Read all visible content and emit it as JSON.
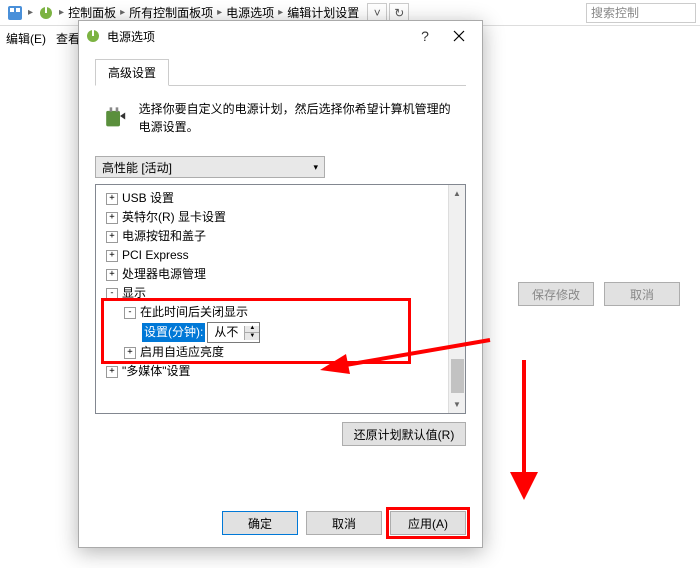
{
  "breadcrumb": {
    "items": [
      "控制面板",
      "所有控制面板项",
      "电源选项",
      "编辑计划设置"
    ],
    "search_placeholder": "搜索控制"
  },
  "menubar": {
    "edit": "编辑(E)",
    "view": "查看"
  },
  "bg_buttons": {
    "save": "保存修改",
    "cancel": "取消"
  },
  "dialog": {
    "title": "电源选项",
    "tab": "高级设置",
    "description": "选择你要自定义的电源计划，然后选择你希望计算机管理的电源设置。",
    "plan_selected": "高性能 [活动]",
    "tree": {
      "usb": "USB 设置",
      "intel": "英特尔(R) 显卡设置",
      "power_btn": "电源按钮和盖子",
      "pci": "PCI Express",
      "cpu": "处理器电源管理",
      "display": "显示",
      "display_off": "在此时间后关闭显示",
      "setting_label": "设置(分钟):",
      "setting_value": "从不",
      "adaptive": "启用自适应亮度",
      "multimedia": "\"多媒体\"设置"
    },
    "restore": "还原计划默认值(R)",
    "ok": "确定",
    "cancel": "取消",
    "apply": "应用(A)"
  }
}
